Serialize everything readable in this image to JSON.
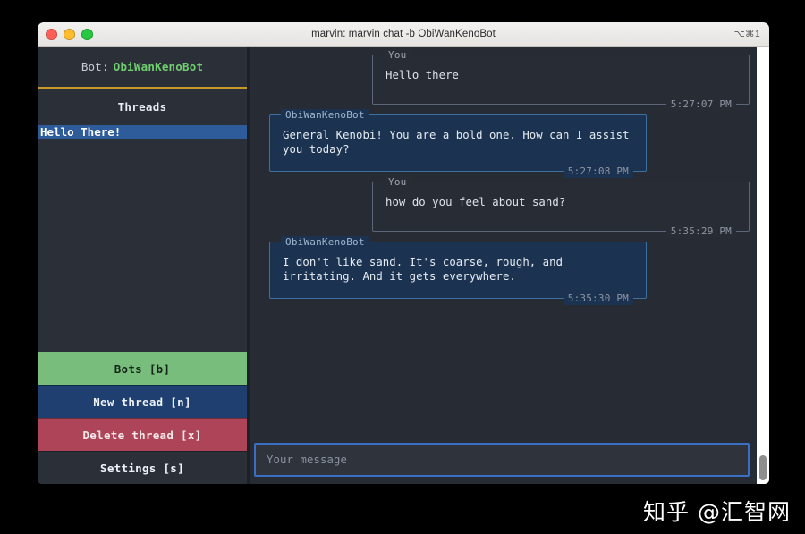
{
  "window": {
    "title": "marvin: marvin chat -b ObiWanKenoBot",
    "shortcut": "⌥⌘1",
    "traffic_lights": [
      "close-red",
      "minimize-yellow",
      "zoom-green"
    ]
  },
  "sidebar": {
    "bot_label": "Bot:",
    "bot_name": "ObiWanKenoBot",
    "threads_title": "Threads",
    "threads": [
      {
        "label": "Hello There!",
        "selected": true
      }
    ],
    "buttons": [
      {
        "label": "Bots [b]",
        "style": "bots",
        "color": "#79bd7c"
      },
      {
        "label": "New thread [n]",
        "style": "newth",
        "color": "#1e3f6f"
      },
      {
        "label": "Delete thread [x]",
        "style": "delth",
        "color": "#ad4458"
      },
      {
        "label": "Settings [s]",
        "style": "settings",
        "color": "#2b2f38"
      }
    ]
  },
  "chat": {
    "messages": [
      {
        "author": "You",
        "role": "user",
        "text": "Hello there",
        "time": "5:27:07 PM"
      },
      {
        "author": "ObiWanKenoBot",
        "role": "bot",
        "text": "General Kenobi! You are a bold one. How can I assist you today?",
        "time": "5:27:08 PM"
      },
      {
        "author": "You",
        "role": "user",
        "text": "how do you feel about sand?",
        "time": "5:35:29 PM"
      },
      {
        "author": "ObiWanKenoBot",
        "role": "bot",
        "text": "I don't like sand. It's coarse, rough, and irritating. And it gets everywhere.",
        "time": "5:35:30 PM"
      }
    ],
    "input": {
      "value": "",
      "placeholder": "Your message",
      "focus_color": "#3b6fc4"
    }
  },
  "watermark": {
    "text": "知乎 @汇智网"
  },
  "colors": {
    "background": "#000000",
    "window_bg": "#272b33",
    "sidebar_bg": "#2b2f38",
    "accent_gold": "#c79a27",
    "accent_green": "#6fcf6f",
    "thread_selected": "#2e5c9a",
    "bot_bubble": "#1b3350",
    "user_bubble": "#282c34"
  }
}
